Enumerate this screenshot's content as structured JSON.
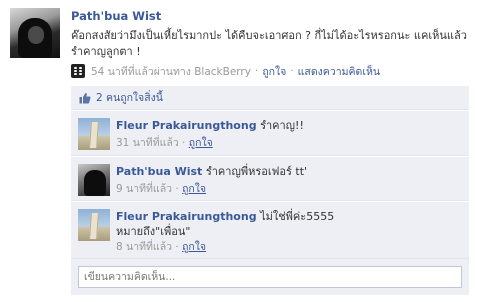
{
  "post": {
    "author": "Path'bua Wist",
    "message": "ค๊อกสงสัยว่ามึงเป็นเหี้ยไรมากปะ ได้คืบจะเอาศอก ? กี่ไม่ได้อะไรหรอกนะ แคเห็นแล้วรำคาญลูกตา !",
    "time": "54 นาทีที่แล้วผ่านทาง BlackBerry",
    "like_link": "ถูกใจ",
    "comment_link": "แสดงความคิดเห็น",
    "separator": "·"
  },
  "likes": {
    "text": "2 คนถูกใจสิ่งนี้"
  },
  "comments": [
    {
      "name": "Fleur Prakairungthong",
      "text": "รำคาญ!!",
      "time": "31 นาทีที่แล้ว",
      "like": "ถูกใจ"
    },
    {
      "name": "Path'bua Wist",
      "text": "รำคาญพี่หรอเฟอร์ tt'",
      "time": "9 นาทีที่แล้ว",
      "like": "ถูกใจ"
    },
    {
      "name": "Fleur Prakairungthong",
      "text": "ไม่ใช่พี่ค่ะ5555",
      "text2": "หมายถึง\"เพื่อน\"",
      "time": "8 นาทีที่แล้ว",
      "like": "ถูกใจ"
    }
  ],
  "composer": {
    "placeholder": "เขียนความคิดเห็น..."
  },
  "colors": {
    "link": "#3b5998",
    "panel": "#edeff4",
    "meta": "#999999"
  },
  "icons": [
    "blackberry-icon",
    "thumbs-up-icon"
  ]
}
